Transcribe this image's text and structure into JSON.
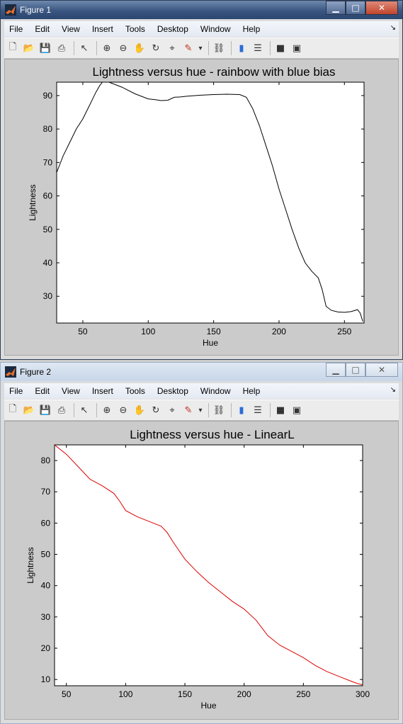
{
  "windows": [
    {
      "title": "Figure 1",
      "menu": [
        "File",
        "Edit",
        "View",
        "Insert",
        "Tools",
        "Desktop",
        "Window",
        "Help"
      ],
      "toolbar_icons": [
        "new-file-icon",
        "open-folder-icon",
        "save-icon",
        "print-icon",
        "pointer-icon",
        "zoom-in-icon",
        "zoom-out-icon",
        "pan-hand-icon",
        "rotate-3d-icon",
        "data-cursor-icon",
        "brush-icon",
        "brush-dropdown-icon",
        "link-plot-icon",
        "colorbar-icon",
        "legend-icon",
        "hide-plot-tools-icon",
        "show-plot-tools-icon"
      ],
      "chart_data": {
        "type": "line",
        "title": "Lightness versus hue - rainbow with blue bias",
        "xlabel": "Hue",
        "ylabel": "Lightness",
        "xlim": [
          30,
          265
        ],
        "ylim": [
          22,
          94
        ],
        "xticks": [
          50,
          100,
          150,
          200,
          250
        ],
        "yticks": [
          30,
          40,
          50,
          60,
          70,
          80,
          90
        ],
        "grid": false,
        "series": [
          {
            "color": "#000000",
            "x": [
              30,
              35,
              40,
              45,
              50,
              55,
              60,
              63,
              65,
              70,
              80,
              90,
              100,
              105,
              110,
              115,
              120,
              125,
              130,
              140,
              150,
              160,
              170,
              175,
              180,
              185,
              190,
              195,
              200,
              205,
              210,
              215,
              220,
              225,
              230,
              233,
              236,
              240,
              245,
              250,
              255,
              260,
              262,
              264
            ],
            "y": [
              67,
              72,
              76,
              80,
              83,
              87,
              91,
              93,
              94,
              94,
              92.5,
              90.5,
              89,
              88.8,
              88.5,
              88.6,
              89.5,
              89.6,
              89.8,
              90.1,
              90.3,
              90.4,
              90.3,
              89.5,
              86,
              81,
              75,
              69,
              62,
              56,
              50,
              44.5,
              40,
              37.5,
              35.5,
              32,
              27,
              25.8,
              25.3,
              25.2,
              25.4,
              26,
              25,
              22.5
            ]
          }
        ]
      }
    },
    {
      "title": "Figure 2",
      "menu": [
        "File",
        "Edit",
        "View",
        "Insert",
        "Tools",
        "Desktop",
        "Window",
        "Help"
      ],
      "toolbar_icons": [
        "new-file-icon",
        "open-folder-icon",
        "save-icon",
        "print-icon",
        "pointer-icon",
        "zoom-in-icon",
        "zoom-out-icon",
        "pan-hand-icon",
        "rotate-3d-icon",
        "data-cursor-icon",
        "brush-icon",
        "brush-dropdown-icon",
        "link-plot-icon",
        "colorbar-icon",
        "legend-icon",
        "hide-plot-tools-icon",
        "show-plot-tools-icon"
      ],
      "chart_data": {
        "type": "line",
        "title": "Lightness versus hue - LinearL",
        "xlabel": "Hue",
        "ylabel": "Lightness",
        "xlim": [
          40,
          300
        ],
        "ylim": [
          8,
          85
        ],
        "xticks": [
          50,
          100,
          150,
          200,
          250,
          300
        ],
        "yticks": [
          10,
          20,
          30,
          40,
          50,
          60,
          70,
          80
        ],
        "grid": false,
        "series": [
          {
            "color": "#dd0000",
            "x": [
              40,
              50,
              60,
              70,
              80,
              90,
              95,
              100,
              110,
              120,
              130,
              135,
              140,
              150,
              160,
              170,
              180,
              190,
              200,
              210,
              220,
              230,
              240,
              250,
              260,
              270,
              280,
              290,
              295,
              300
            ],
            "y": [
              85,
              82,
              78,
              74,
              72,
              69.5,
              67,
              64,
              62,
              60.5,
              59,
              57,
              54,
              48.5,
              44.5,
              41,
              38,
              35,
              32.5,
              29,
              24,
              21,
              19,
              17,
              14.5,
              12.5,
              11,
              9.5,
              8.8,
              8.3
            ]
          }
        ]
      }
    }
  ],
  "ui": {
    "close_glyph": "✕",
    "min_glyph": "▁",
    "max_glyph": "□",
    "menu_arrow": "↘"
  }
}
